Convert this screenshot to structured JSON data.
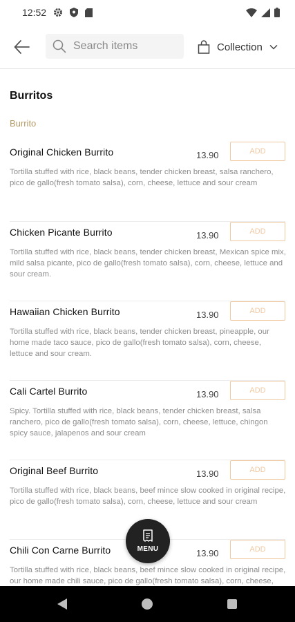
{
  "status_bar": {
    "time": "12:52"
  },
  "header": {
    "search_placeholder": "Search items",
    "collection_label": "Collection"
  },
  "section": {
    "title": "Burritos",
    "subtitle": "Burrito"
  },
  "add_label": "ADD",
  "items": [
    {
      "name": "Original Chicken Burrito",
      "price": "13.90",
      "description": "Tortilla stuffed with rice, black beans, tender chicken breast, salsa ranchero, pico de gallo(fresh tomato salsa), corn,  cheese, lettuce and sour cream"
    },
    {
      "name": "Chicken Picante Burrito",
      "price": "13.90",
      "description": "Tortilla stuffed with rice, black beans, tender chicken breast, Mexican spice mix, mild salsa picante, pico de gallo(fresh tomato salsa), corn, cheese, lettuce and sour cream."
    },
    {
      "name": "Hawaiian Chicken Burrito",
      "price": "13.90",
      "description": "Tortilla stuffed with rice, black beans, tender chicken breast, pineapple, our home made taco sauce, pico de gallo(fresh tomato salsa), corn,  cheese, lettuce and sour cream."
    },
    {
      "name": "Cali Cartel Burrito",
      "price": "13.90",
      "description": "Spicy. Tortilla stuffed with rice, black beans, tender chicken breast, salsa ranchero, pico de gallo(fresh tomato salsa), corn,  cheese, lettuce, chingon spicy sauce, jalapenos and sour cream"
    },
    {
      "name": "Original Beef Burrito",
      "price": "13.90",
      "description": "Tortilla stuffed with rice, black beans, beef mince slow cooked in original recipe, pico de gallo(fresh tomato salsa), corn,  cheese, lettuce and sour cream"
    },
    {
      "name": "Chili Con Carne Burrito",
      "price": "13.90",
      "description": "Tortilla stuffed with rice, black beans, beef mince slow cooked in original recipe, our home made chili sauce, pico de gallo(fresh tomato salsa), corn, cheese, lettuce and sour cream"
    }
  ],
  "fab": {
    "label": "MENU",
    "icon": "receipt-icon"
  },
  "colors": {
    "accent": "#f0c8a0",
    "subtitle": "#b49a66",
    "fab": "#222222"
  }
}
